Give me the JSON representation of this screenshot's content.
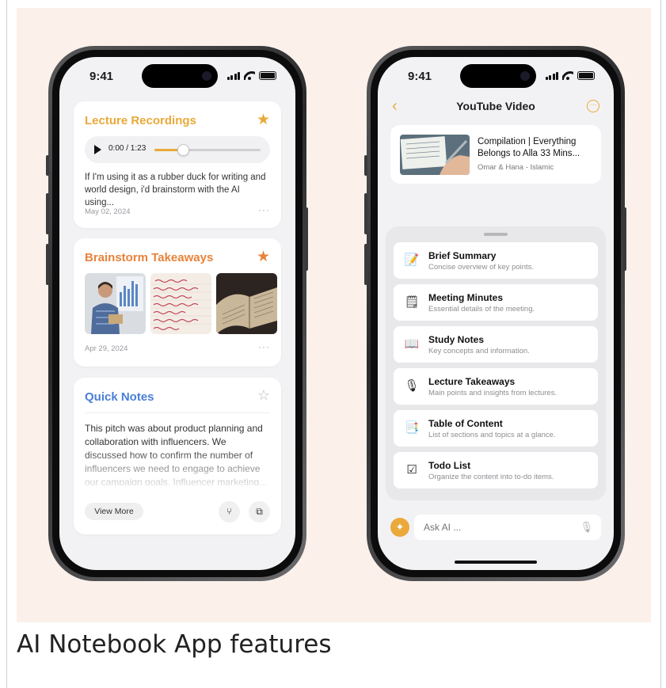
{
  "caption": "AI Notebook App features",
  "colors": {
    "accent": "#e9a93a",
    "orange": "#e8833a",
    "blue": "#4a7fd6",
    "hero_bg": "#fbf1ea"
  },
  "left_phone": {
    "status_time": "9:41",
    "cards": [
      {
        "title": "Lecture Recordings",
        "title_color": "#e9a93a",
        "starred": true,
        "audio_time": "0:00 / 1:23",
        "audio_progress": 0.27,
        "text": "If I'm using it as a rubber duck for writing and world design, i'd brainstorm with the AI using...",
        "date": "May 02, 2024"
      },
      {
        "title": "Brainstorm Takeaways",
        "title_color": "#e8833a",
        "starred": true,
        "date": "Apr 29, 2024"
      },
      {
        "title": "Quick Notes",
        "title_color": "#4a7fd6",
        "starred": false,
        "text": "This pitch was about product planning and collaboration with influencers. We discussed how to confirm the number of influencers we need to engage to achieve our campaign goals. Influencer marketing...",
        "view_more": "View More"
      }
    ]
  },
  "right_phone": {
    "status_time": "9:41",
    "nav_title": "YouTube Video",
    "video": {
      "title": "Compilation | Everything Belongs to Alla 33 Mins...",
      "channel": "Omar & Hana - Islamic"
    },
    "options": [
      {
        "icon": "pencil-paper-icon",
        "glyph": "📝",
        "title": "Brief Summary",
        "subtitle": "Concise overview of key points."
      },
      {
        "icon": "notepad-icon",
        "glyph": "🗒",
        "title": "Meeting Minutes",
        "subtitle": "Essential details of the meeting."
      },
      {
        "icon": "book-icon",
        "glyph": "📖",
        "title": "Study Notes",
        "subtitle": "Key concepts and information."
      },
      {
        "icon": "microphone-icon",
        "glyph": "🎙",
        "title": "Lecture Takeaways",
        "subtitle": "Main points and insights from lectures."
      },
      {
        "icon": "document-icon",
        "glyph": "📑",
        "title": "Table of Content",
        "subtitle": "List of sections and topics at a glance."
      },
      {
        "icon": "checkbox-icon",
        "glyph": "☑",
        "title": "Todo List",
        "subtitle": "Organize the content into to-do items."
      }
    ],
    "ask_placeholder": "Ask AI ..."
  }
}
